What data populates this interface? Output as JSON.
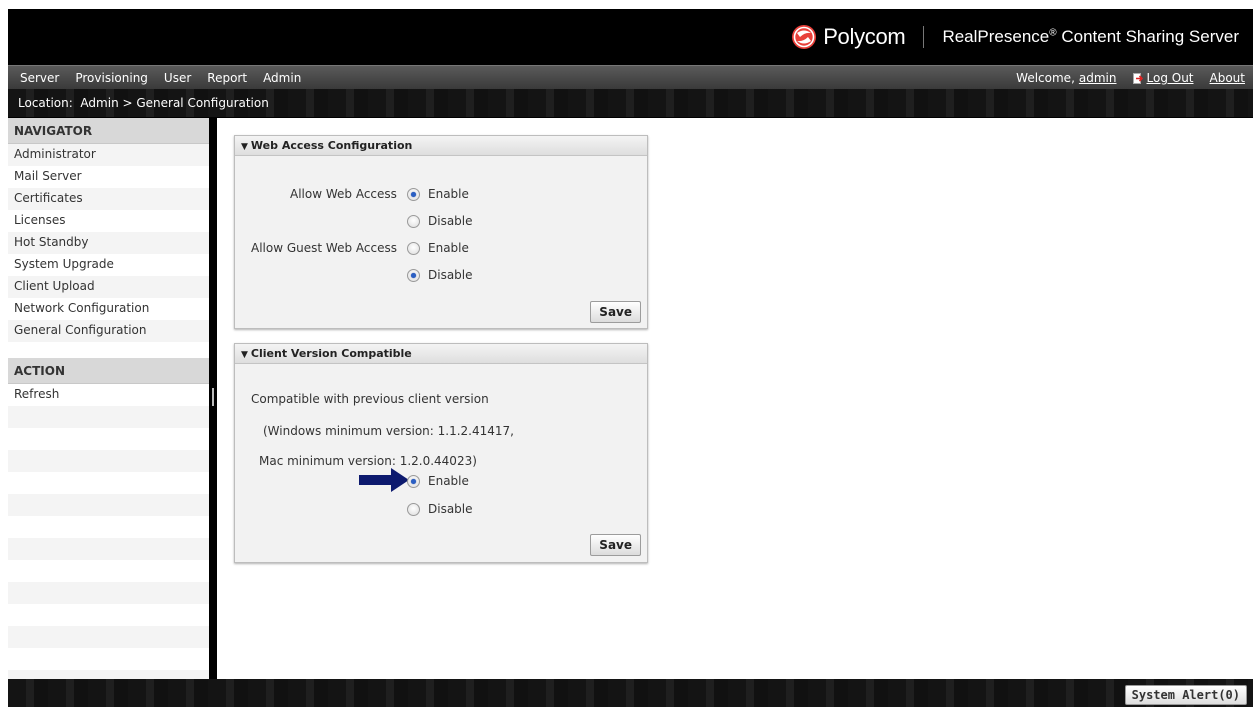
{
  "header": {
    "logo_text": "Polycom",
    "product_name": "RealPresence",
    "product_mark": "®",
    "product_suffix": " Content Sharing Server"
  },
  "menu": {
    "items": [
      "Server",
      "Provisioning",
      "User",
      "Report",
      "Admin"
    ],
    "welcome_text": "Welcome,",
    "welcome_user": "admin",
    "logout_label": "Log Out",
    "about_label": "About"
  },
  "location": {
    "text": "Location:  Admin > General Configuration"
  },
  "sidebar": {
    "navigator_title": "NAVIGATOR",
    "nav_items": [
      "Administrator",
      "Mail Server",
      "Certificates",
      "Licenses",
      "Hot Standby",
      "System Upgrade",
      "Client Upload",
      "Network Configuration",
      "General Configuration"
    ],
    "action_title": "ACTION",
    "action_items": [
      "Refresh"
    ]
  },
  "web_access": {
    "title": "Web Access Configuration",
    "allow_web_label": "Allow Web Access",
    "allow_guest_label": "Allow Guest Web Access",
    "enable_label": "Enable",
    "disable_label": "Disable",
    "allow_web_value": "Enable",
    "allow_guest_value": "Disable",
    "save_label": "Save"
  },
  "client_version": {
    "title": "Client Version Compatible",
    "line1": "Compatible with previous client version",
    "line2": "(Windows minimum version: 1.1.2.41417,",
    "line3": "Mac minimum version: 1.2.0.44023)",
    "enable_label": "Enable",
    "disable_label": "Disable",
    "value": "Enable",
    "save_label": "Save"
  },
  "footer": {
    "alert_label": "System Alert(0)"
  },
  "colors": {
    "arrow": "#0d1a6e",
    "logo_red": "#e8403a",
    "radio_selected": "#2a5fc4"
  }
}
